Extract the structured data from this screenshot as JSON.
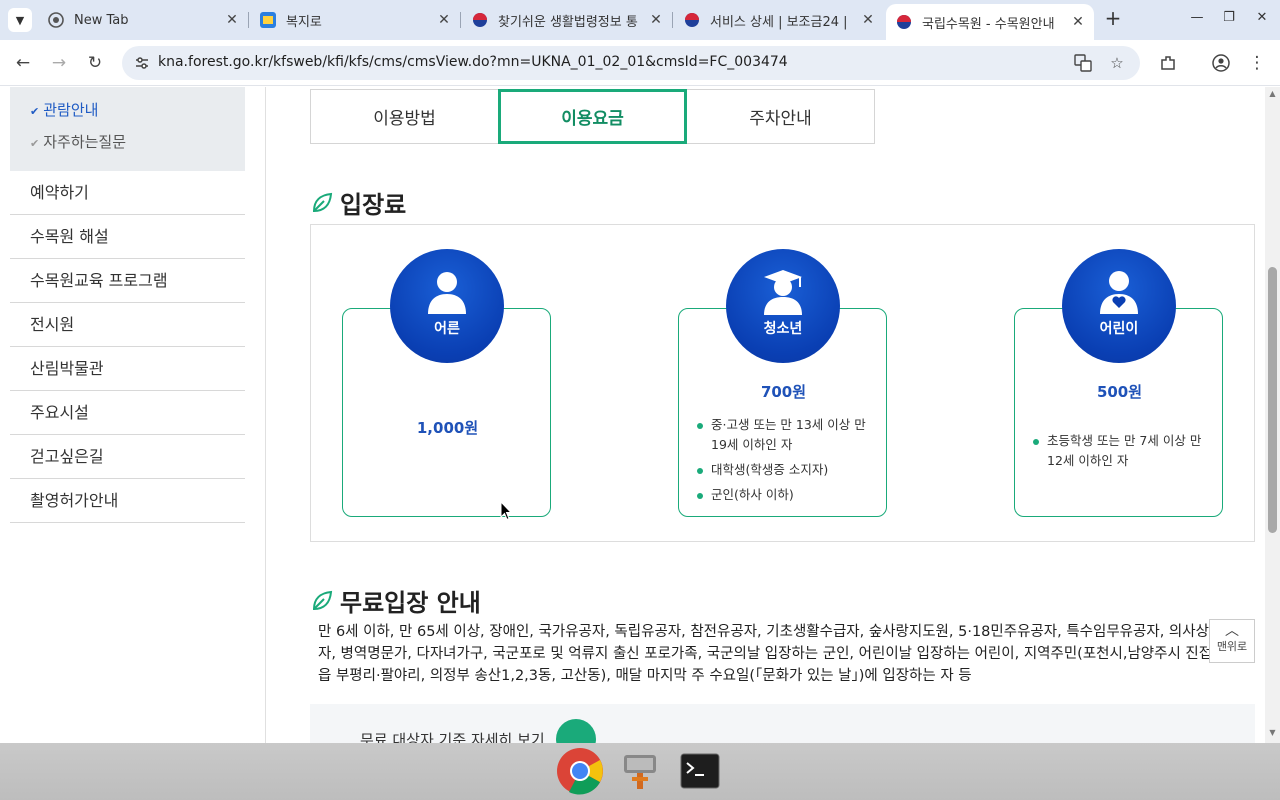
{
  "browser": {
    "tabs": [
      {
        "title": "New Tab",
        "icon": "chrome-icon"
      },
      {
        "title": "복지로",
        "icon": "bokjiro-icon"
      },
      {
        "title": "찾기쉬운 생활법령정보 통",
        "icon": "korea-gov-icon"
      },
      {
        "title": "서비스 상세 | 보조금24 |",
        "icon": "korea-gov-icon"
      },
      {
        "title": "국립수목원 - 수목원안내",
        "icon": "korea-gov-icon",
        "active": true
      }
    ],
    "url": "kna.forest.go.kr/kfsweb/kfi/kfs/cms/cmsView.do?mn=UKNA_01_02_01&cmsId=FC_003474"
  },
  "sidebar": {
    "sub_items": [
      {
        "label": "관람안내",
        "active": true
      },
      {
        "label": "자주하는질문",
        "active": false
      }
    ],
    "menu": [
      "예약하기",
      "수목원 해설",
      "수목원교육 프로그램",
      "전시원",
      "산림박물관",
      "주요시설",
      "걷고싶은길",
      "촬영허가안내"
    ]
  },
  "content_tabs": [
    {
      "label": "이용방법",
      "active": false
    },
    {
      "label": "이용요금",
      "active": true
    },
    {
      "label": "주차안내",
      "active": false
    }
  ],
  "admission": {
    "title": "입장료",
    "cards": [
      {
        "label": "어른",
        "price": "1,000원",
        "items": []
      },
      {
        "label": "청소년",
        "price": "700원",
        "items": [
          "중·고생 또는 만 13세 이상 만 19세 이하인 자",
          "대학생(학생증 소지자)",
          "군인(하사 이하)"
        ]
      },
      {
        "label": "어린이",
        "price": "500원",
        "items": [
          "초등학생 또는 만 7세 이상 만 12세 이하인 자"
        ]
      }
    ]
  },
  "free_entry": {
    "title": "무료입장 안내",
    "text": "만 6세 이하, 만 65세 이상, 장애인, 국가유공자, 독립유공자, 참전유공자, 기초생활수급자, 숲사랑지도원, 5·18민주유공자, 특수임무유공자, 의사상자, 병역명문가, 다자녀가구, 국군포로 및 억류지 출신 포로가족, 국군의날 입장하는 군인, 어린이날 입장하는 어린이, 지역주민(포천시,남양주시 진접읍 부평리·팔야리, 의정부 송산1,2,3동, 고산동), 매달 마지막 주 수요일(「문화가 있는 날」)에 입장하는 자 등",
    "link_label": "무료 대상자 기준 자세히 보기"
  },
  "top_button_label": "맨위로",
  "colors": {
    "accent_green": "#1aaa7a",
    "circle_blue": "#0a3fb3",
    "price_blue": "#1f52b8"
  }
}
